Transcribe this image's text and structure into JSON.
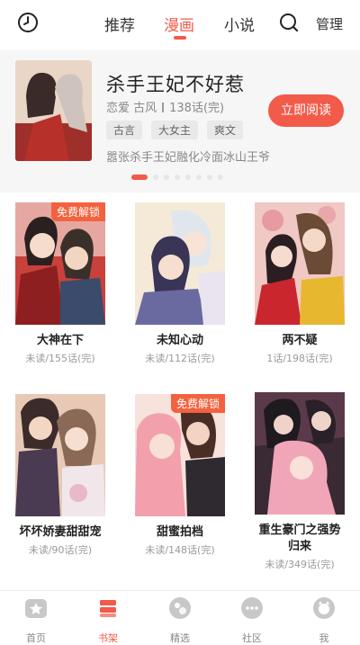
{
  "header": {
    "tabs": [
      {
        "label": "推荐"
      },
      {
        "label": "漫画"
      },
      {
        "label": "小说"
      }
    ],
    "manage_label": "管理"
  },
  "featured": {
    "title": "杀手王妃不好惹",
    "genres": "恋爱 古风",
    "episodes": "138话(完)",
    "tags": [
      "古言",
      "大女主",
      "爽文"
    ],
    "read_button": "立即阅读",
    "description": "嚣张杀手王妃融化冷面冰山王爷"
  },
  "comics": [
    {
      "title": "大神在下",
      "sub": "未读/155话(完)",
      "badge": "免费解锁"
    },
    {
      "title": "未知心动",
      "sub": "未读/112话(完)",
      "badge": ""
    },
    {
      "title": "两不疑",
      "sub": "1话/198话(完)",
      "badge": ""
    },
    {
      "title": "坏坏娇妻甜甜宠",
      "sub": "未读/90话(完)",
      "badge": ""
    },
    {
      "title": "甜蜜拍档",
      "sub": "未读/148话(完)",
      "badge": "免费解锁"
    },
    {
      "title": "重生豪门之强势归来",
      "sub": "未读/349话(完)",
      "badge": ""
    }
  ],
  "bottom_nav": [
    {
      "label": "首页"
    },
    {
      "label": "书架"
    },
    {
      "label": "精选"
    },
    {
      "label": "社区"
    },
    {
      "label": "我"
    }
  ],
  "colors": {
    "accent": "#f25a4a",
    "badge": "#f2623f"
  }
}
